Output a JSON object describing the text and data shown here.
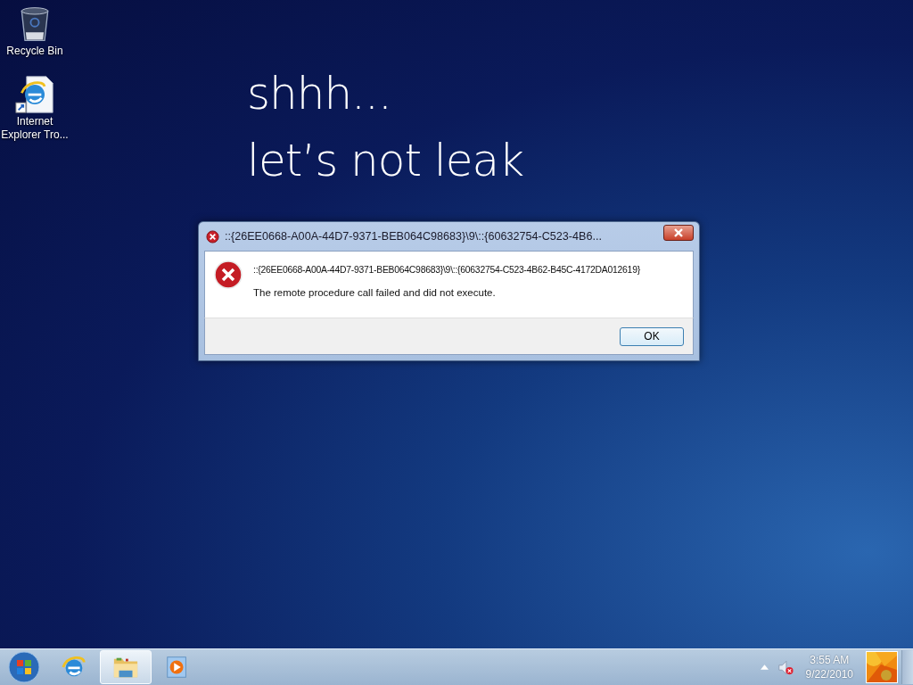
{
  "desktop_icons": [
    {
      "kind": "recycle-bin",
      "label": "Recycle Bin"
    },
    {
      "kind": "ie-shortcut",
      "label": "Internet Explorer Tro..."
    }
  ],
  "wallpaper_text": [
    "shhh...",
    "let’s not leak"
  ],
  "dialog": {
    "title": "::{26EE0668-A00A-44D7-9371-BEB064C98683}\\9\\::{60632754-C523-4B6...",
    "message": "::{26EE0668-A00A-44D7-9371-BEB064C98683}\\9\\::{60632754-C523-4B62-B45C-4172DA012619}",
    "detail": "The remote procedure call failed and did not execute.",
    "buttons": [
      "OK"
    ]
  },
  "taskbar": {
    "items": [
      {
        "kind": "start",
        "selected": false
      },
      {
        "kind": "ie",
        "selected": false
      },
      {
        "kind": "explorer",
        "selected": true
      },
      {
        "kind": "media",
        "selected": false
      }
    ],
    "tray": {
      "volume_muted": true,
      "time": "3:55 AM",
      "date": "9/22/2010"
    }
  }
}
